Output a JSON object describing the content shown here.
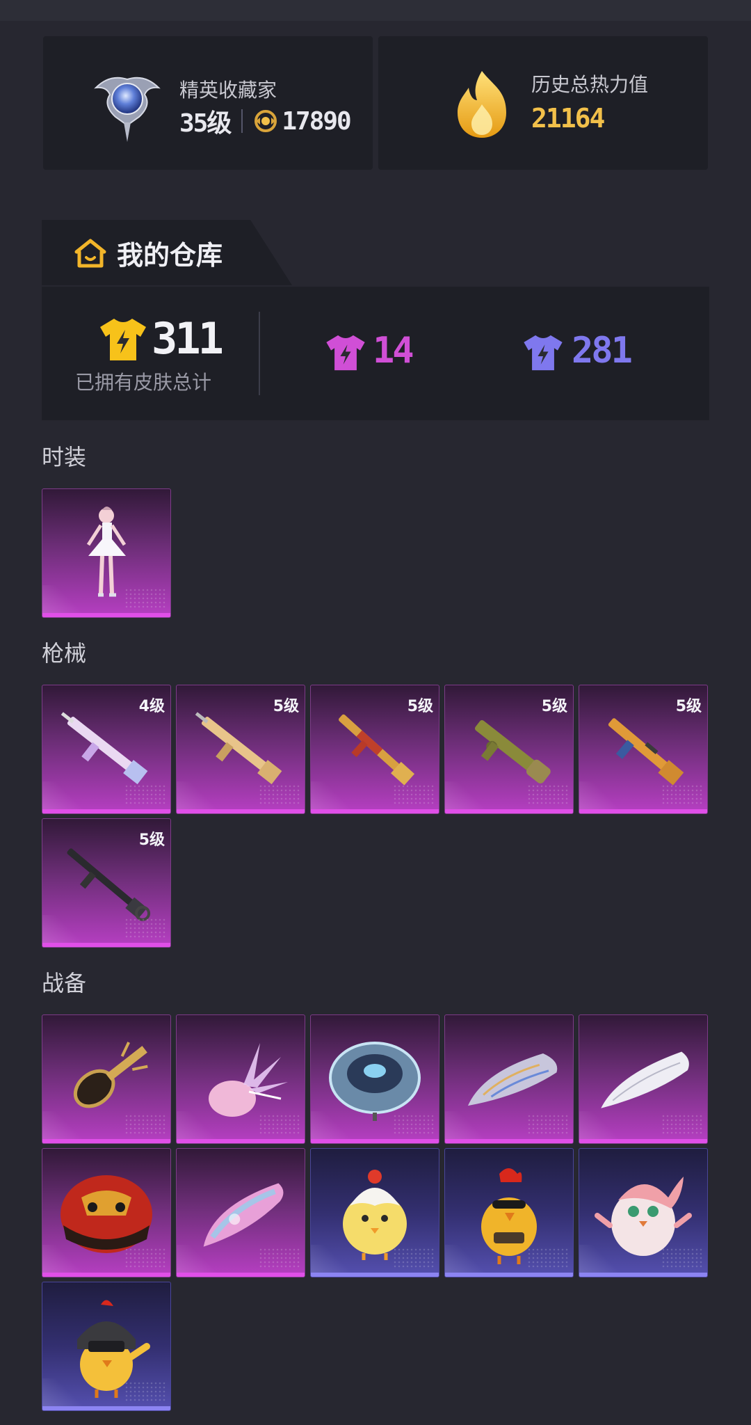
{
  "profile": {
    "title": "精英收藏家",
    "level": "35级",
    "points": "17890",
    "heat_title": "历史总热力值",
    "heat_value": "21164"
  },
  "warehouse": {
    "title": "我的仓库",
    "total_count": "311",
    "total_label": "已拥有皮肤总计",
    "purple_count": "14",
    "blue_count": "281"
  },
  "sections": {
    "fashion": {
      "title": "时装",
      "items": [
        {
          "name": "outfit-ballerina-icon",
          "rarity": "purple"
        }
      ]
    },
    "guns": {
      "title": "枪械",
      "items": [
        {
          "level": "4级",
          "rarity": "purple",
          "icon": "rifle-pink-icon"
        },
        {
          "level": "5级",
          "rarity": "purple",
          "icon": "rifle-gold-icon"
        },
        {
          "level": "5级",
          "rarity": "purple",
          "icon": "rifle-red-icon"
        },
        {
          "level": "5级",
          "rarity": "purple",
          "icon": "smg-camo-icon"
        },
        {
          "level": "5级",
          "rarity": "purple",
          "icon": "rifle-orange-icon"
        },
        {
          "level": "5级",
          "rarity": "purple",
          "icon": "lmg-black-icon"
        }
      ]
    },
    "gear": {
      "title": "战备",
      "items": [
        {
          "rarity": "purple",
          "icon": "pan-gold-icon"
        },
        {
          "rarity": "purple",
          "icon": "crystal-bag-icon"
        },
        {
          "rarity": "purple",
          "icon": "parachute-disc-icon"
        },
        {
          "rarity": "purple",
          "icon": "glider-silver-icon"
        },
        {
          "rarity": "purple",
          "icon": "glider-white-icon"
        },
        {
          "rarity": "purple",
          "icon": "dragon-helmet-icon"
        },
        {
          "rarity": "purple",
          "icon": "parachute-pink-icon"
        },
        {
          "rarity": "blue",
          "icon": "chick-egg-icon"
        },
        {
          "rarity": "blue",
          "icon": "rooster-icon"
        },
        {
          "rarity": "blue",
          "icon": "pink-bird-icon"
        },
        {
          "rarity": "blue",
          "icon": "helmet-chick-icon"
        }
      ]
    }
  },
  "colors": {
    "background": "#272730",
    "card": "#1e1f26",
    "purple": "#d04fd6",
    "blue": "#7f78ee",
    "gold": "#f2c04a"
  }
}
